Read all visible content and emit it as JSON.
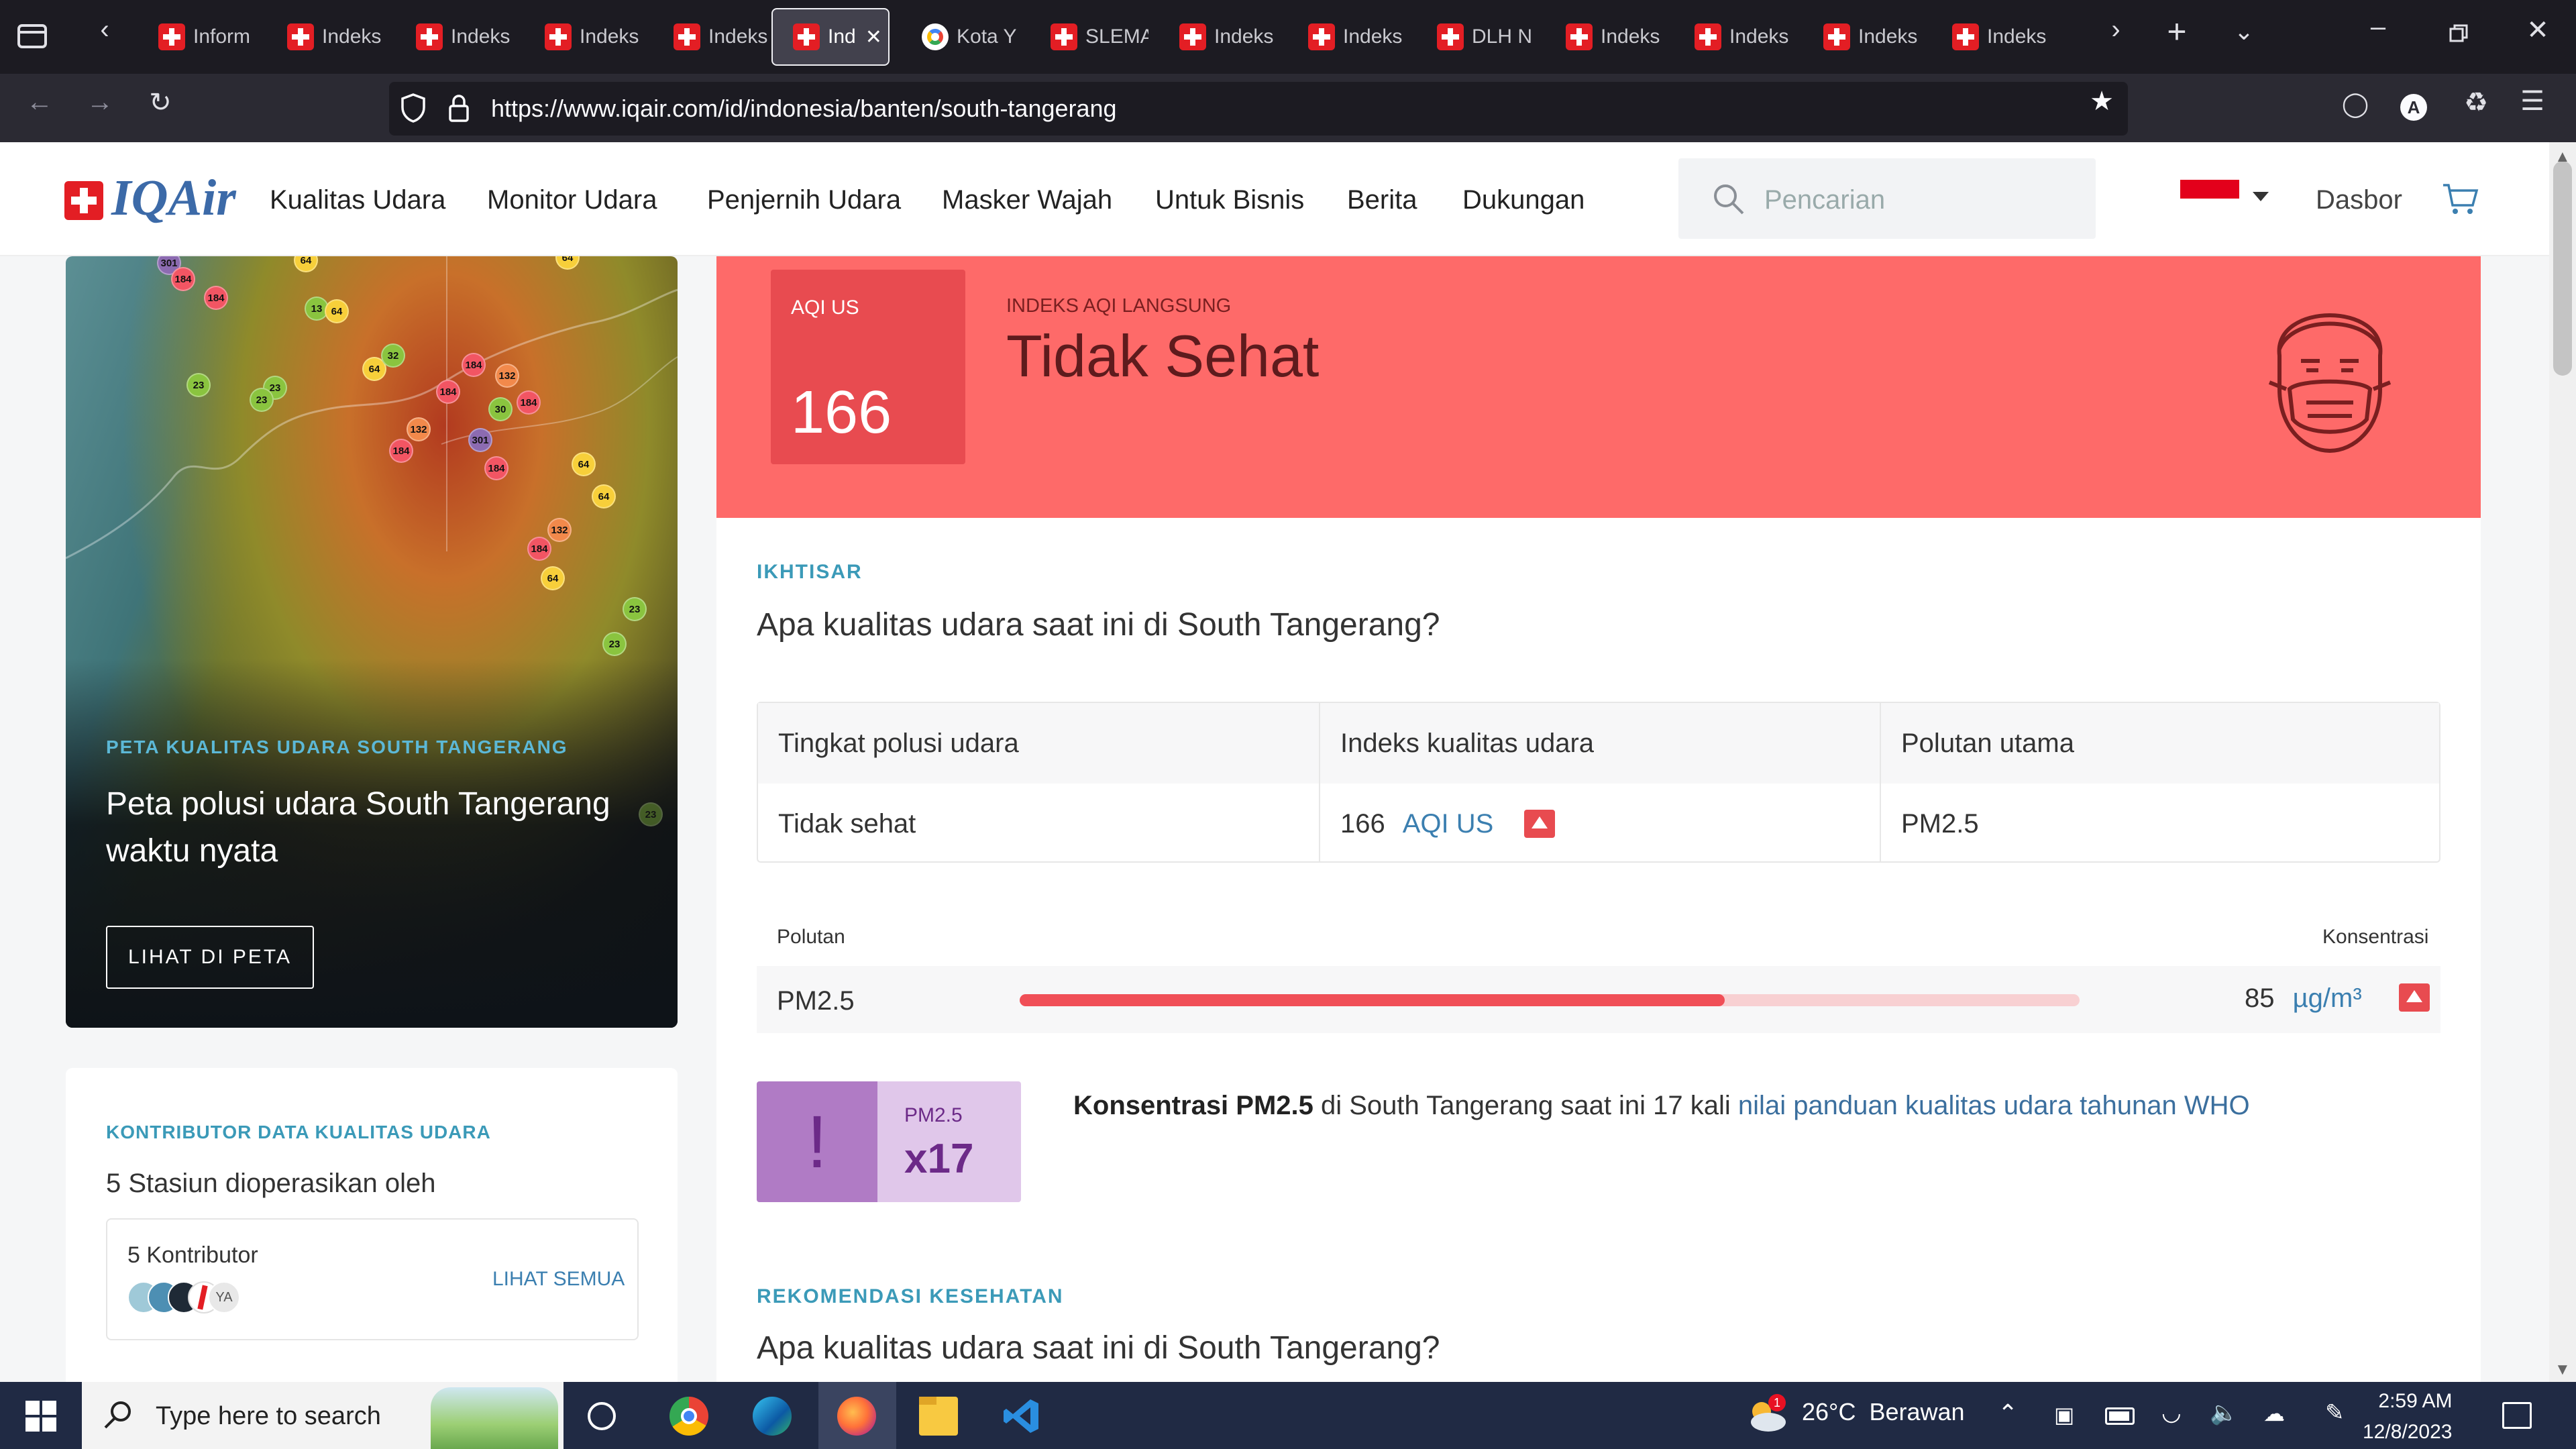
{
  "browser": {
    "tabs": [
      {
        "label": "Inform",
        "icon": "iqair-favicon"
      },
      {
        "label": "Indeks",
        "icon": "iqair-favicon"
      },
      {
        "label": "Indeks",
        "icon": "iqair-favicon"
      },
      {
        "label": "Indeks",
        "icon": "iqair-favicon"
      },
      {
        "label": "Indeks",
        "icon": "iqair-favicon"
      },
      {
        "label": "Ind",
        "icon": "iqair-favicon",
        "active": true
      },
      {
        "label": "Kota Y",
        "icon": "google-favicon"
      },
      {
        "label": "SLEMA",
        "icon": "iqair-favicon"
      },
      {
        "label": "Indeks",
        "icon": "iqair-favicon"
      },
      {
        "label": "Indeks",
        "icon": "iqair-favicon"
      },
      {
        "label": "DLH N",
        "icon": "iqair-favicon"
      },
      {
        "label": "Indeks",
        "icon": "iqair-favicon"
      },
      {
        "label": "Indeks",
        "icon": "iqair-favicon"
      },
      {
        "label": "Indeks",
        "icon": "iqair-favicon"
      },
      {
        "label": "Indeks",
        "icon": "iqair-favicon"
      }
    ],
    "url": "https://www.iqair.com/id/indonesia/banten/south-tangerang"
  },
  "header": {
    "logo": "IQAir",
    "nav": [
      "Kualitas Udara",
      "Monitor Udara",
      "Penjernih Udara",
      "Masker Wajah",
      "Untuk Bisnis",
      "Berita",
      "Dukungan"
    ],
    "search_placeholder": "Pencarian",
    "dashboard": "Dasbor"
  },
  "map_card": {
    "tag": "PETA KUALITAS UDARA SOUTH TANGERANG",
    "title": "Peta polusi udara South Tangerang waktu nyata",
    "button": "LIHAT DI PETA",
    "markers": [
      "301",
      "184",
      "184",
      "64",
      "13",
      "64",
      "64",
      "23",
      "23",
      "23",
      "64",
      "32",
      "184",
      "132",
      "184",
      "30",
      "184",
      "132",
      "184",
      "301",
      "184",
      "64",
      "64",
      "132",
      "184",
      "64",
      "23",
      "23",
      "23"
    ]
  },
  "contributors": {
    "tag": "KONTRIBUTOR DATA KUALITAS UDARA",
    "subtitle": "5 Stasiun dioperasikan oleh",
    "count": "5 Kontributor",
    "see_all": "LIHAT SEMUA",
    "avatar_initials": "YA"
  },
  "aqi": {
    "label": "AQI US",
    "value": "166",
    "live_label": "INDEKS AQI LANGSUNG",
    "status": "Tidak Sehat",
    "color": "#fe6a69"
  },
  "overview": {
    "tag": "IKHTISAR",
    "question": "Apa kualitas udara saat ini di South Tangerang?",
    "table_headers": [
      "Tingkat polusi udara",
      "Indeks kualitas udara",
      "Polutan utama"
    ],
    "row": {
      "level": "Tidak sehat",
      "aqi_value": "166",
      "aqi_unit": "AQI US",
      "main_pollutant": "PM2.5"
    }
  },
  "pollutants": {
    "header_left": "Polutan",
    "header_right": "Konsentrasi",
    "items": [
      {
        "name": "PM2.5",
        "value": "85",
        "unit": "µg/m³",
        "level_fraction": 0.665
      }
    ]
  },
  "who": {
    "badge_icon": "!",
    "badge_label": "PM2.5",
    "badge_value": "x17",
    "text_bold": "Konsentrasi PM2.5",
    "text_mid": " di South Tangerang saat ini 17 kali ",
    "text_link": "nilai panduan kualitas udara tahunan WHO"
  },
  "health": {
    "tag": "REKOMENDASI KESEHATAN",
    "question": "Apa kualitas udara saat ini di South Tangerang?"
  },
  "taskbar": {
    "search_placeholder": "Type here to search",
    "weather": "26°C  Berawan",
    "weather_badge": "1",
    "time": "2:59 AM",
    "date": "12/8/2023"
  }
}
